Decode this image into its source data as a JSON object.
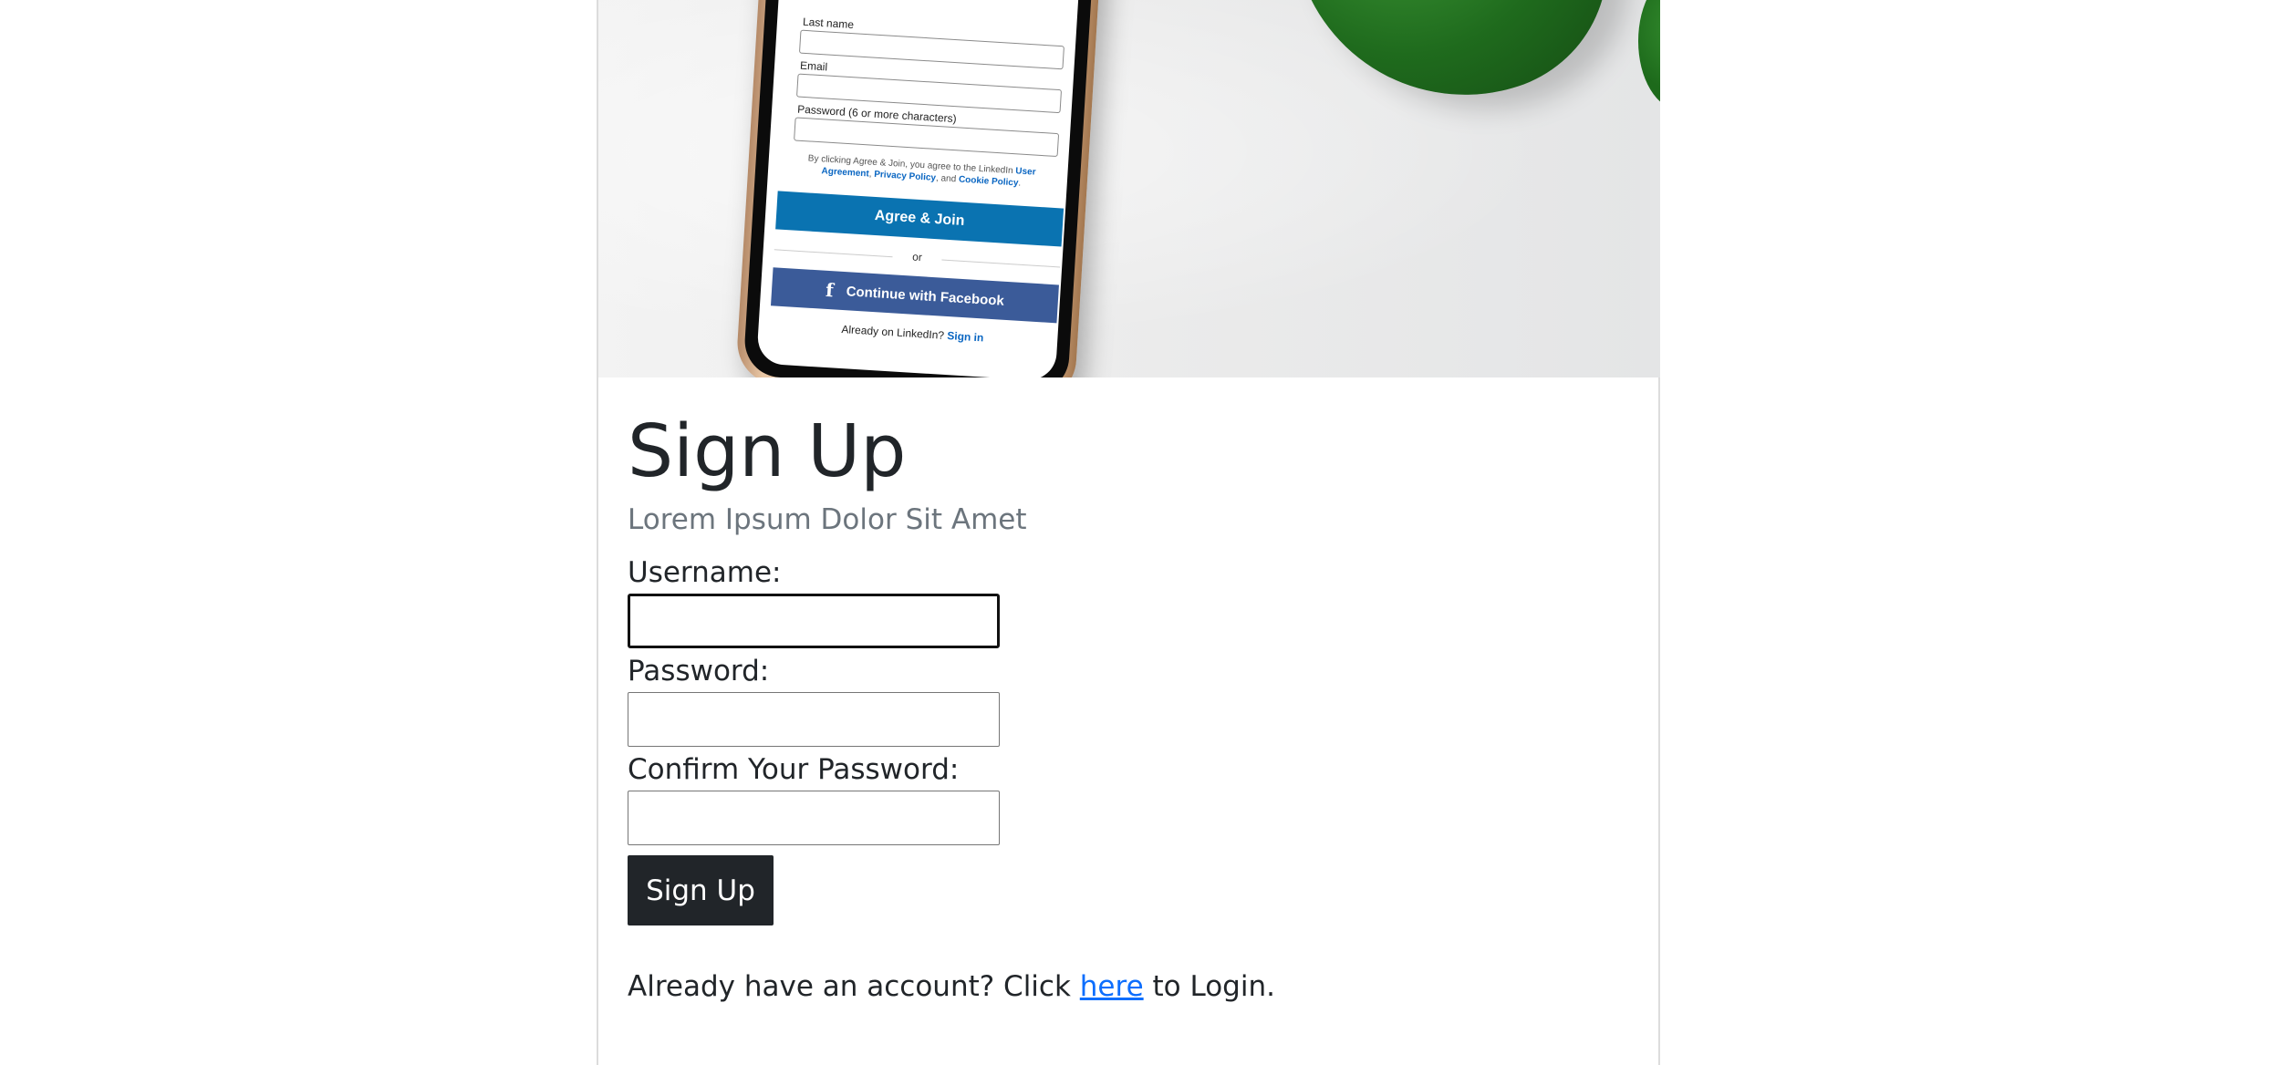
{
  "hero": {
    "phone_screen": {
      "last_name_label": "Last name",
      "email_label": "Email",
      "password_label": "Password (6 or more characters)",
      "terms_prefix": "By clicking Agree & Join, you agree to the LinkedIn",
      "terms_user_agreement": "User Agreement",
      "terms_sep1": ", ",
      "terms_privacy": "Privacy Policy",
      "terms_sep2": ", and ",
      "terms_cookie": "Cookie Policy",
      "terms_end": ".",
      "agree_button": "Agree & Join",
      "or_text": "or",
      "facebook_icon_glyph": "f",
      "facebook_button": "Continue with Facebook",
      "already_text": "Already on LinkedIn?",
      "sign_in_link": "Sign in"
    },
    "icons": [
      "facebook-icon"
    ],
    "colors": {
      "linkedin_blue": "#0a73b1",
      "facebook_blue": "#3b5b99",
      "leaf_green": "#1f6b1d"
    }
  },
  "form": {
    "title": "Sign Up",
    "subtitle": "Lorem Ipsum Dolor Sit Amet",
    "username_label": "Username:",
    "username_value": "",
    "password_label": "Password:",
    "password_value": "",
    "confirm_label": "Confirm Your Password:",
    "confirm_value": "",
    "submit_label": "Sign Up",
    "login_prefix": "Already have an account? Click ",
    "login_link": "here",
    "login_suffix": " to Login.",
    "colors": {
      "button_bg": "#212529",
      "subtitle": "#6c757d",
      "link": "#0d6efd"
    }
  }
}
